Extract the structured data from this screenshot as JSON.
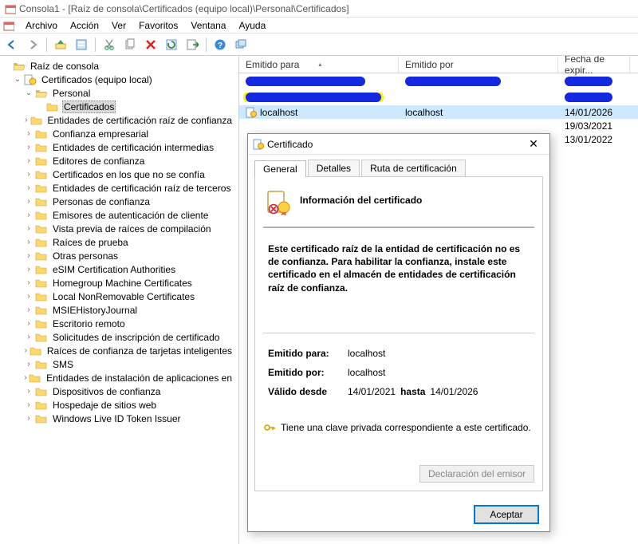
{
  "titlebar": {
    "text": "Consola1 - [Raíz de consola\\Certificados (equipo local)\\Personal\\Certificados]"
  },
  "menu": {
    "items": [
      "Archivo",
      "Acción",
      "Ver",
      "Favoritos",
      "Ventana",
      "Ayuda"
    ]
  },
  "tree": {
    "root": "Raíz de consola",
    "certLocal": "Certificados (equipo local)",
    "personal": "Personal",
    "certificados": "Certificados",
    "children": [
      "Entidades de certificación raíz de confianza",
      "Confianza empresarial",
      "Entidades de certificación intermedias",
      "Editores de confianza",
      "Certificados en los que no se confía",
      "Entidades de certificación raíz de terceros",
      "Personas de confianza",
      "Emisores de autenticación de cliente",
      "Vista previa de raíces de compilación",
      "Raíces de prueba",
      "Otras personas",
      "eSIM Certification Authorities",
      "Homegroup Machine Certificates",
      "Local NonRemovable Certificates",
      "MSIEHistoryJournal",
      "Escritorio remoto",
      "Solicitudes de inscripción de certificado",
      "Raíces de confianza de tarjetas inteligentes",
      "SMS",
      "Entidades de instalación de aplicaciones en",
      "Dispositivos de confianza",
      "Hospedaje de sitios web",
      "Windows Live ID Token Issuer"
    ]
  },
  "list": {
    "columns": {
      "para": "Emitido para",
      "por": "Emitido por",
      "fecha": "Fecha de expir..."
    },
    "rows": [
      {
        "para": "localhost",
        "por": "localhost",
        "date": "14/01/2026",
        "selected": true
      },
      {
        "para": "",
        "por": "",
        "date": "19/03/2021"
      },
      {
        "para": "",
        "por": "",
        "date": "13/01/2022"
      }
    ]
  },
  "dialog": {
    "title": "Certificado",
    "tabs": {
      "general": "General",
      "detalles": "Detalles",
      "ruta": "Ruta de certificación"
    },
    "info_head": "Información del certificado",
    "warning": "Este certificado raíz de la entidad de certificación no es de confianza. Para habilitar la confianza, instale este certificado en el almacén de entidades de certificación raíz de confianza.",
    "issued_to_lbl": "Emitido para:",
    "issued_to_val": "localhost",
    "issued_by_lbl": "Emitido por:",
    "issued_by_val": "localhost",
    "valid_lbl": "Válido desde",
    "valid_from": "14/01/2021",
    "valid_to_lbl": "hasta",
    "valid_to": "14/01/2026",
    "private_key": "Tiene una clave privada correspondiente a este certificado.",
    "issuer_statement": "Declaración del emisor",
    "ok": "Aceptar"
  }
}
